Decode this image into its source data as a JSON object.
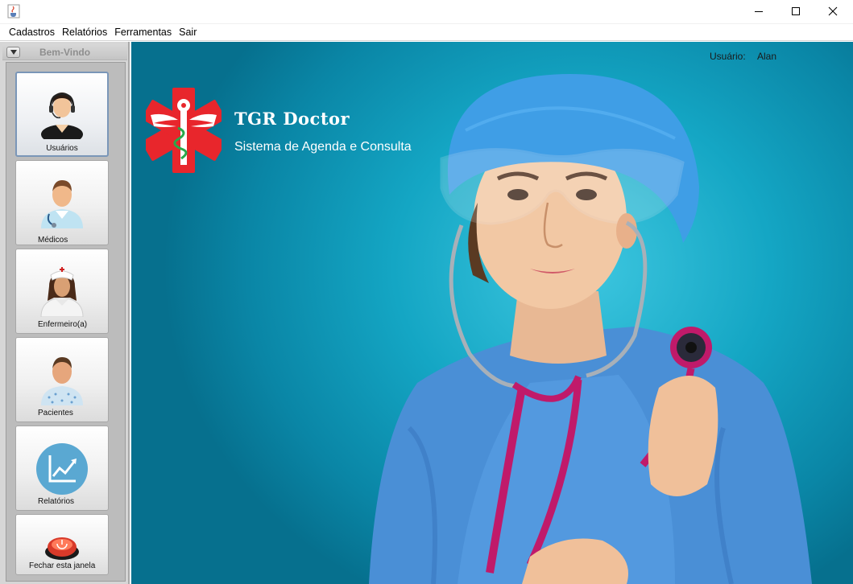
{
  "window": {
    "icon": "java-cup-icon",
    "controls": [
      "minimize-icon",
      "maximize-icon",
      "close-icon"
    ]
  },
  "menu": {
    "items": [
      "Cadastros",
      "Relatórios",
      "Ferramentas",
      "Sair"
    ]
  },
  "sidebar": {
    "title": "Bem-Vindo",
    "buttons": [
      {
        "label": "Usuários",
        "icon": "user-headset-icon"
      },
      {
        "label": "Médicos",
        "icon": "doctor-icon"
      },
      {
        "label": "Enfermeiro(a)",
        "icon": "nurse-icon"
      },
      {
        "label": "Pacientes",
        "icon": "patient-icon"
      },
      {
        "label": "Relatórios",
        "icon": "chart-growth-icon"
      },
      {
        "label": "Fechar esta janela",
        "icon": "power-button-icon"
      }
    ]
  },
  "header": {
    "user_label": "Usuário:",
    "user_name": "Alan"
  },
  "brand": {
    "name": "TGR Doctor",
    "subtitle": "Sistema de Agenda e Consulta"
  },
  "colors": {
    "background": "#14a6c4",
    "logo_red": "#e8262c",
    "scrubs": "#4a8fd6",
    "stethoscope": "#c01a6a"
  }
}
